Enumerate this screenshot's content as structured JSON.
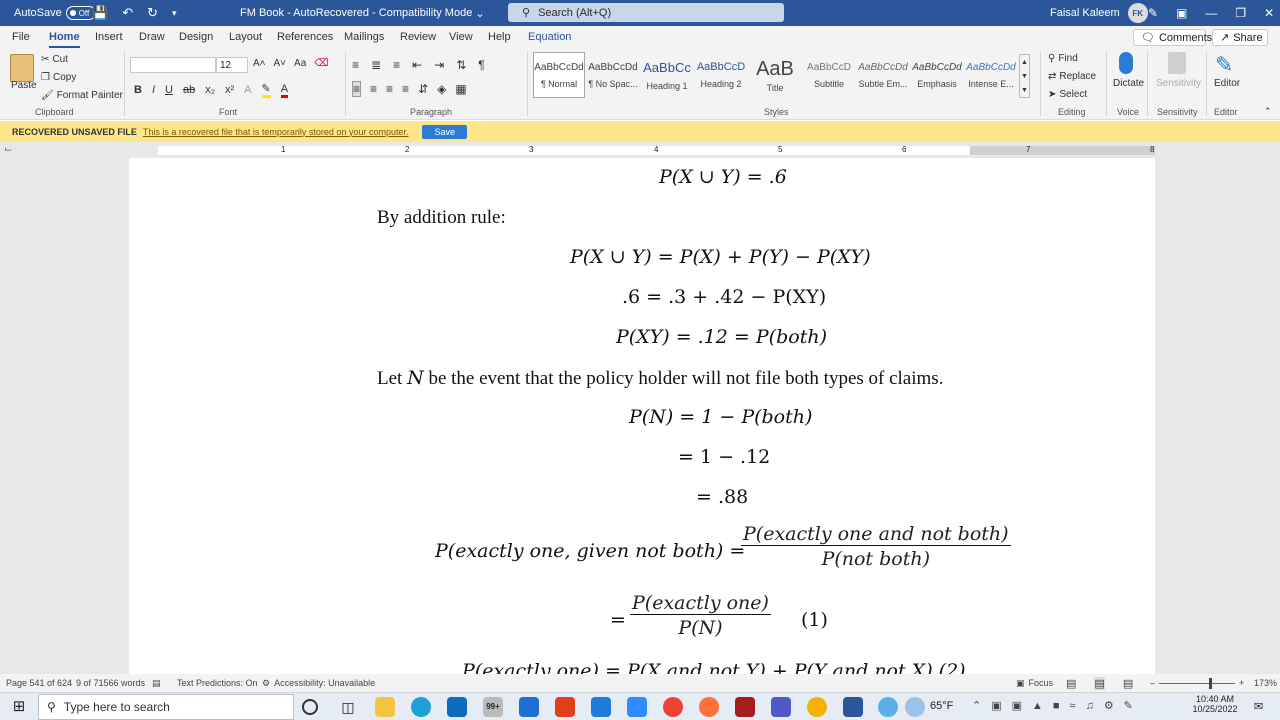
{
  "titlebar": {
    "autosave_label": "AutoSave",
    "autosave_state": "Off",
    "doc_title": "FM Book  -  AutoRecovered  -  Compatibility Mode",
    "search_placeholder": "Search (Alt+Q)",
    "user_name": "Faisal Kaleem",
    "user_initials": "FK"
  },
  "tabs": [
    "File",
    "Home",
    "Insert",
    "Draw",
    "Design",
    "Layout",
    "References",
    "Mailings",
    "Review",
    "View",
    "Help",
    "Equation"
  ],
  "tab_actions": {
    "comments": "Comments",
    "share": "Share"
  },
  "ribbon": {
    "clipboard": {
      "paste": "Paste",
      "cut": "Cut",
      "copy": "Copy",
      "format_painter": "Format Painter",
      "group": "Clipboard"
    },
    "font": {
      "font_name": "",
      "font_size": "12",
      "bold": "B",
      "italic": "I",
      "underline": "U",
      "strike": "ab",
      "sub": "x₂",
      "sup": "x²",
      "grow": "A˄",
      "shrink": "A˅",
      "case": "Aa",
      "clear": "A",
      "group": "Font"
    },
    "paragraph": {
      "group": "Paragraph"
    },
    "styles": {
      "items": [
        {
          "preview": "AaBbCcDd",
          "name": "¶ Normal"
        },
        {
          "preview": "AaBbCcDd",
          "name": "¶ No Spac..."
        },
        {
          "preview": "AaBbCc",
          "name": "Heading 1"
        },
        {
          "preview": "AaBbCcD",
          "name": "Heading 2"
        },
        {
          "preview": "AaB",
          "name": "Title"
        },
        {
          "preview": "AaBbCcD",
          "name": "Subtitle"
        },
        {
          "preview": "AaBbCcDd",
          "name": "Subtle Em..."
        },
        {
          "preview": "AaBbCcDd",
          "name": "Emphasis"
        },
        {
          "preview": "AaBbCcDd",
          "name": "Intense E..."
        }
      ],
      "group": "Styles"
    },
    "editing": {
      "find": "Find",
      "replace": "Replace",
      "select": "Select",
      "group": "Editing"
    },
    "voice": {
      "dictate": "Dictate",
      "group": "Voice"
    },
    "sensitivity": {
      "label": "Sensitivity",
      "group": "Sensitivity"
    },
    "editor": {
      "label": "Editor",
      "group": "Editor"
    }
  },
  "recovery": {
    "label": "RECOVERED UNSAVED FILE",
    "message": "This is a recovered file that is temporarily stored on your computer.",
    "save": "Save"
  },
  "ruler": {
    "marks": [
      "1",
      "2",
      "3",
      "4",
      "5",
      "6",
      "7",
      "8"
    ]
  },
  "document": {
    "l1": "P(X ∪ Y) = .6",
    "l2": "By addition rule:",
    "l3": "P(X ∪ Y) = P(X) + P(Y) − P(XY)",
    "l4": ".6 = .3 + .42 − P(XY)",
    "l5": "P(XY) = .12 = P(both)",
    "l6a": "Let ",
    "l6b": "N",
    "l6c": " be the event that the policy holder will not file both types of claims.",
    "l7": "P(N) = 1 − P(both)",
    "l8": "= 1 − .12",
    "l9": "= .88",
    "l10_lhs": "P(exactly one, given not both) =",
    "l10_num": "P(exactly one and not both)",
    "l10_den": "P(not both)",
    "l11_eq": "=",
    "l11_num": "P(exactly one)",
    "l11_den": "P(N)",
    "l11_tag": "(1)",
    "l12": "P(exactly one) = P(X and not Y) + P(Y and not X)    (2)"
  },
  "status": {
    "page": "Page 541 of 624",
    "words": "9 of 71566 words",
    "predictions": "Text Predictions: On",
    "accessibility": "Accessibility: Unavailable",
    "focus": "Focus",
    "zoom": "173%"
  },
  "taskbar": {
    "search_placeholder": "Type here to search",
    "badge": "99+",
    "weather": "65°F",
    "time": "10:40 AM",
    "date": "10/25/2022"
  }
}
